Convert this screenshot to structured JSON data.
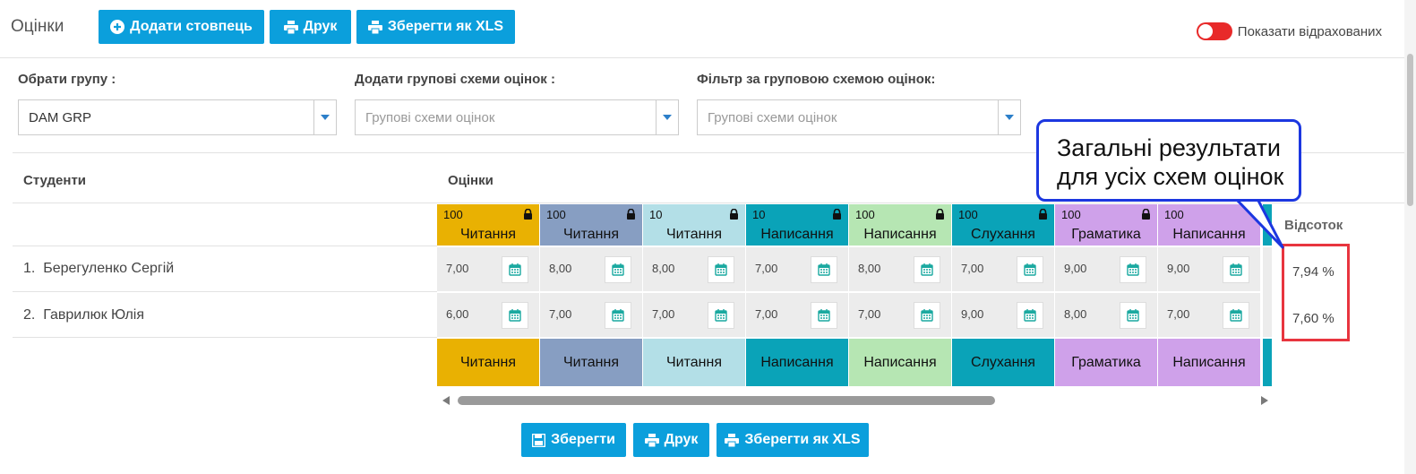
{
  "header": {
    "title": "Оцінки",
    "add_column": "Додати стовпець",
    "print": "Друк",
    "save_xls": "Зберегти як XLS",
    "show_expelled": "Показати відрахованих"
  },
  "filters": {
    "group_label": "Обрати групу :",
    "group_value": "DAM GRP",
    "add_schemes_label": "Додати групові схеми оцінок :",
    "add_schemes_placeholder": "Групові схеми оцінок",
    "filter_label": "Фільтр за груповою схемою оцінок:",
    "filter_placeholder": "Групові схеми оцінок"
  },
  "table": {
    "students_header": "Студенти",
    "grades_header": "Оцінки",
    "percent_header": "Відсоток",
    "columns": [
      {
        "max": "100",
        "name": "Читання",
        "color": "#e9b102",
        "locked": true
      },
      {
        "max": "100",
        "name": "Читання",
        "color": "#879ec2",
        "locked": true
      },
      {
        "max": "10",
        "name": "Читання",
        "color": "#b3dfe7",
        "locked": true
      },
      {
        "max": "10",
        "name": "Написання",
        "color": "#0aa3b8",
        "locked": true
      },
      {
        "max": "100",
        "name": "Написання",
        "color": "#b6e6b3",
        "locked": true
      },
      {
        "max": "100",
        "name": "Слухання",
        "color": "#0aa3b8",
        "locked": true
      },
      {
        "max": "100",
        "name": "Граматика",
        "color": "#cfa1ea",
        "locked": true
      },
      {
        "max": "100",
        "name": "Написання",
        "color": "#cfa1ea",
        "locked": false
      }
    ],
    "students": [
      {
        "num": "1.",
        "name": "Берегуленко Сергій",
        "grades": [
          "7,00",
          "8,00",
          "8,00",
          "7,00",
          "8,00",
          "7,00",
          "9,00",
          "9,00"
        ],
        "percent": "7,94 %"
      },
      {
        "num": "2.",
        "name": "Гаврилюк Юлія",
        "grades": [
          "6,00",
          "7,00",
          "7,00",
          "7,00",
          "7,00",
          "9,00",
          "8,00",
          "7,00"
        ],
        "percent": "7,60 %"
      }
    ]
  },
  "footer": {
    "save": "Зберегти",
    "print": "Друк",
    "save_xls": "Зберегти як XLS"
  },
  "callout": {
    "line1": "Загальні результати",
    "line2": "для усіх схем оцінок"
  },
  "colors": {
    "primary": "#0b9fdc",
    "toggle_off": "#e82a2a",
    "highlight": "#e8353f",
    "callout_border": "#1c37e0",
    "calendar_icon": "#1aa9a0"
  }
}
